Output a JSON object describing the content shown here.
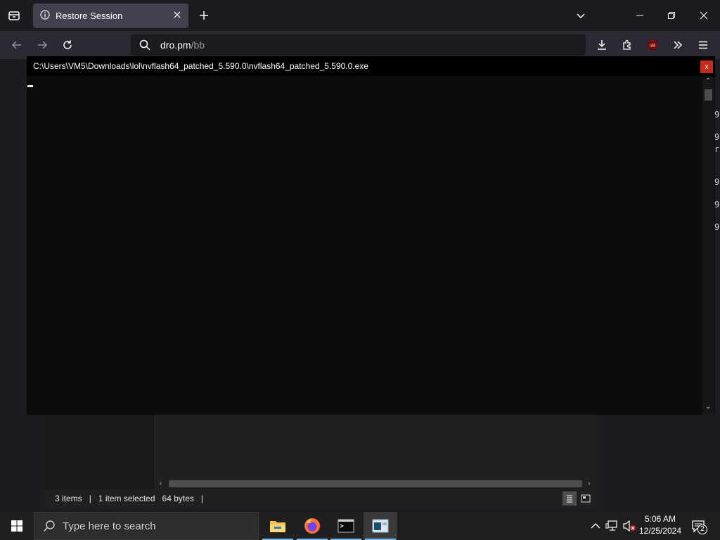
{
  "browser": {
    "tab_title": "Restore Session",
    "url_host": "dro.pm",
    "url_path": "/bb"
  },
  "console": {
    "title": "C:\\Users\\VM5\\Downloads\\lol\\nvflash64_patched_5.590.0\\nvflash64_patched_5.590.0.exe",
    "close_label": "x",
    "right_edge_chars": [
      "9",
      "9",
      "r",
      "9",
      "9",
      "9"
    ]
  },
  "explorer": {
    "status_items": "3 items",
    "status_selected": "1 item selected",
    "status_size": "64 bytes"
  },
  "taskbar": {
    "search_placeholder": "Type here to search",
    "time": "5:06 AM",
    "date": "12/25/2024",
    "notification_count": "2"
  },
  "icons": {
    "tab_list": "tab-list-icon",
    "info": "info-icon",
    "close": "close-icon",
    "new_tab": "plus-icon",
    "back": "back-arrow-icon",
    "forward": "forward-arrow-icon",
    "reload": "reload-icon",
    "search": "search-icon",
    "download": "download-icon",
    "extensions": "puzzle-icon",
    "ublock": "ublock-icon",
    "overflow": "chevrons-right-icon",
    "menu": "hamburger-icon"
  },
  "colors": {
    "firefox_dark": "#1c1b22",
    "tab_active": "#42414d",
    "console_bg": "#0c0c0c",
    "close_red": "#c42b1c",
    "taskbar_accent": "#76b9ed"
  }
}
